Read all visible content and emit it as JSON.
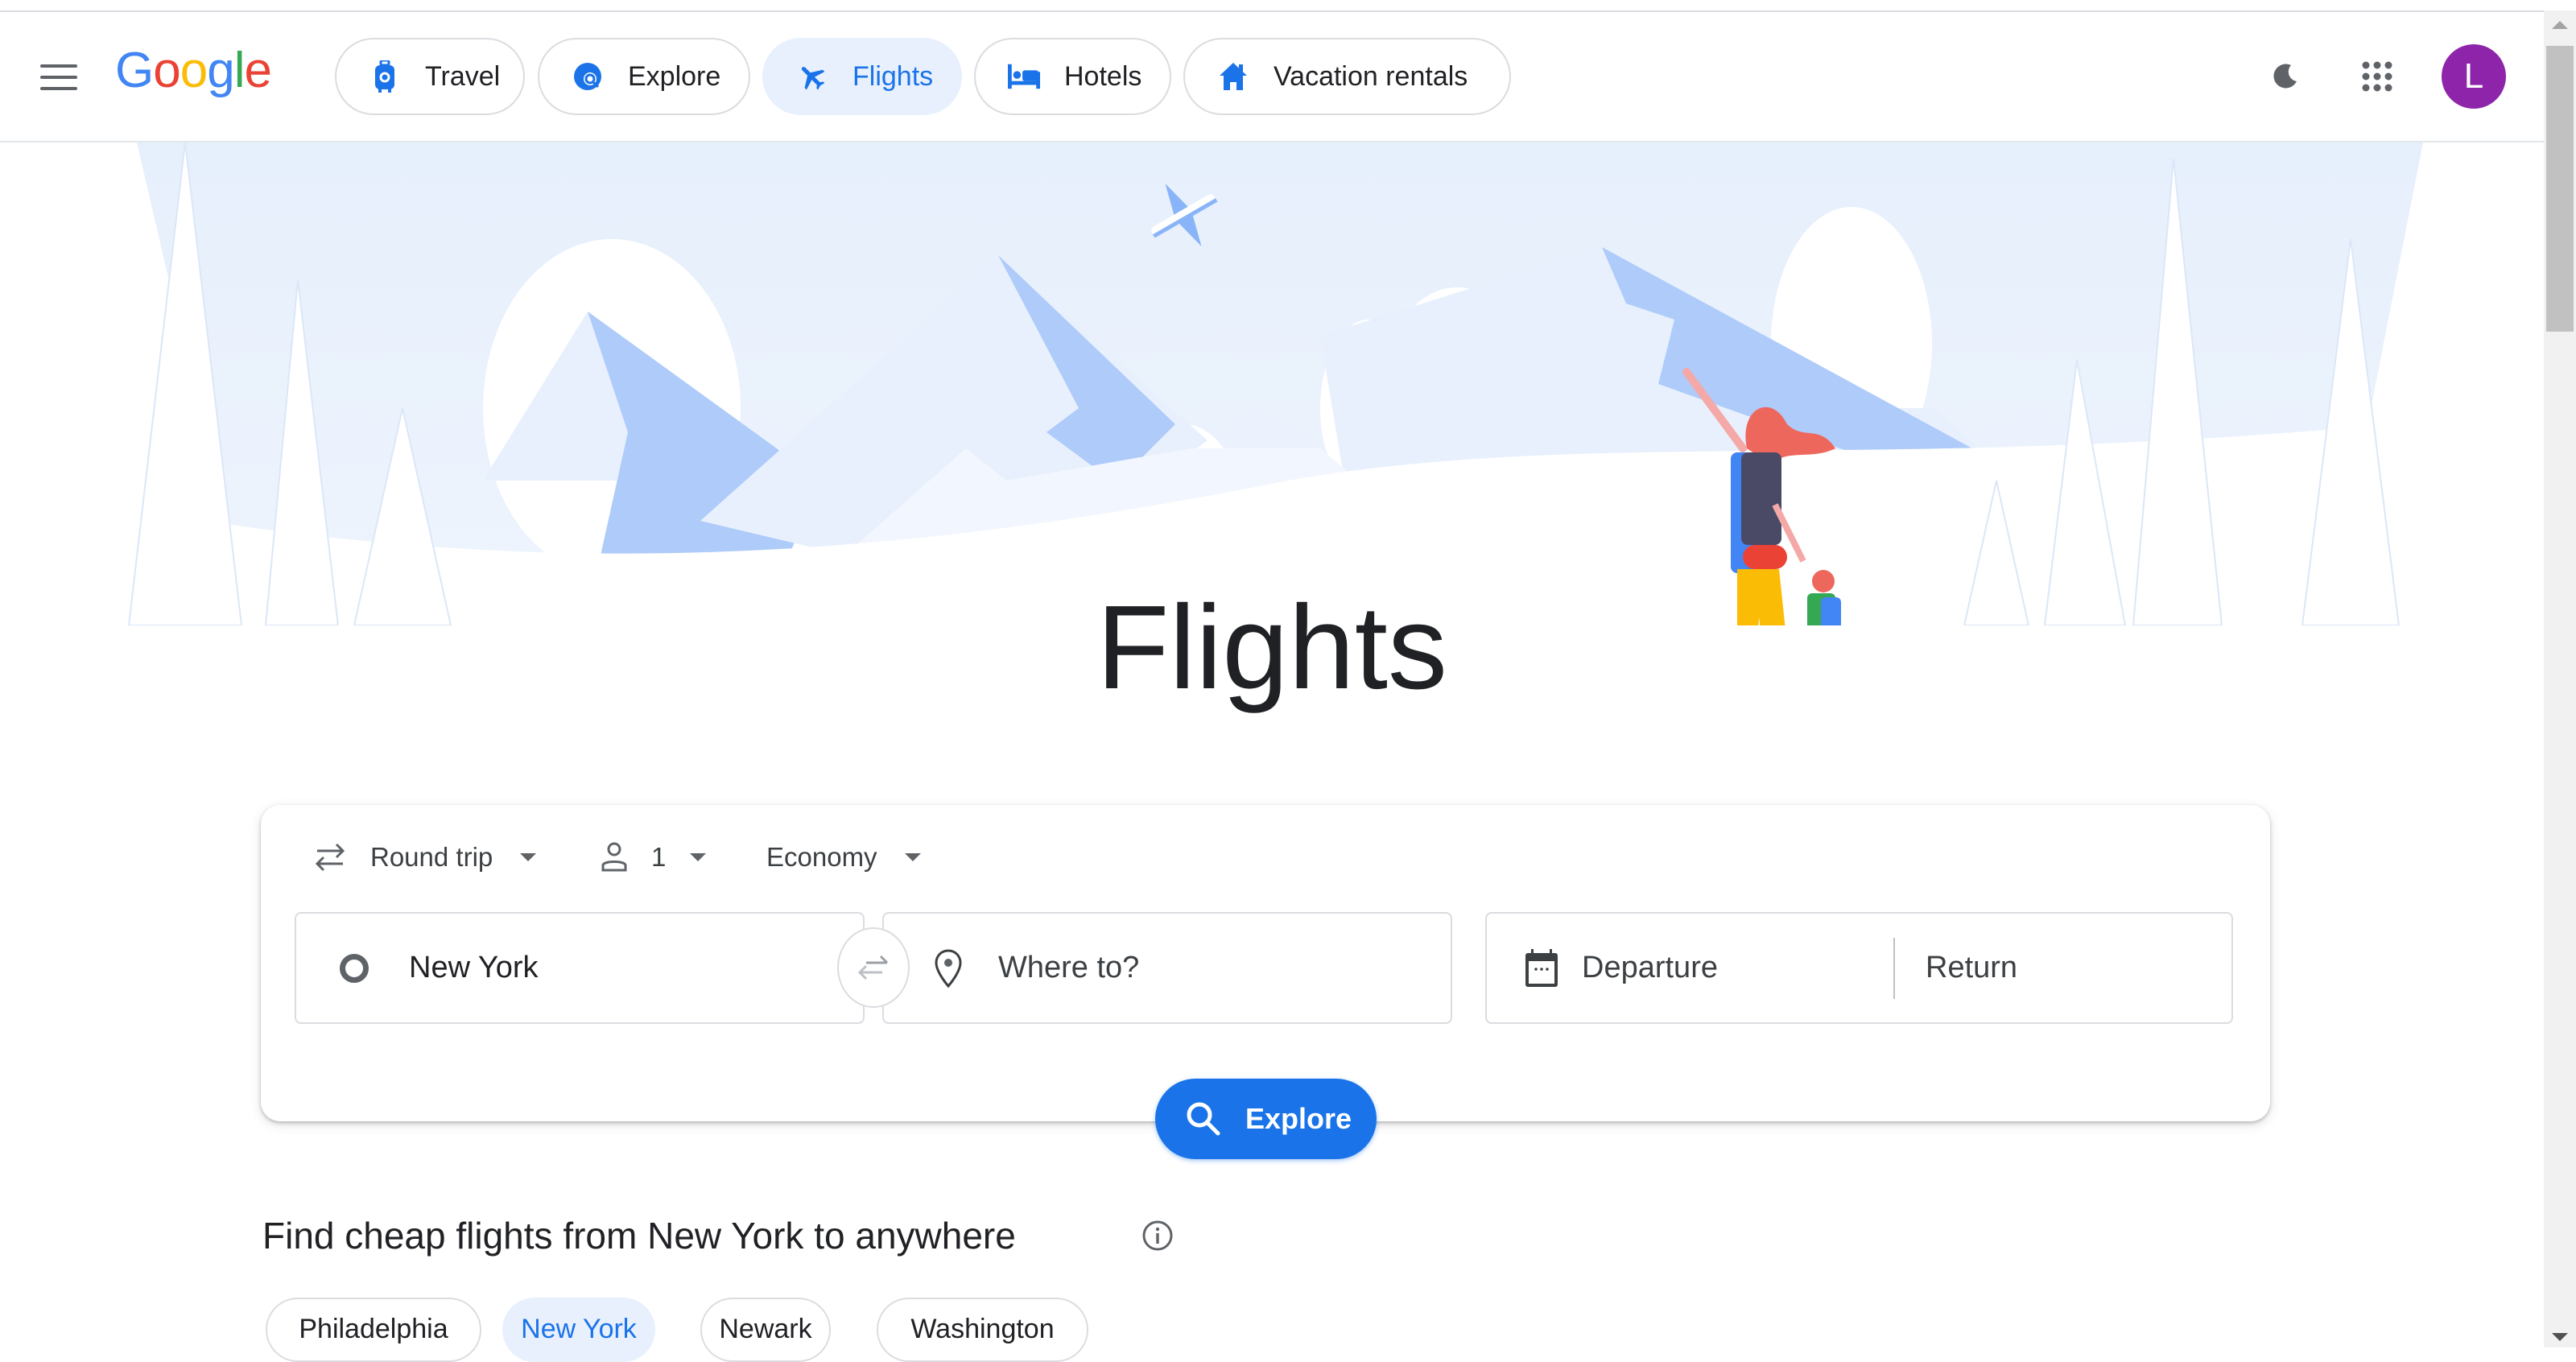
{
  "header": {
    "menu_icon": "hamburger-menu-icon",
    "logo": [
      "G",
      "o",
      "o",
      "g",
      "l",
      "e"
    ],
    "logo_colors": [
      "#4285f4",
      "#ea4335",
      "#fbbc05",
      "#4285f4",
      "#34a853",
      "#ea4335"
    ],
    "tabs": [
      {
        "label": "Travel",
        "icon": "luggage-icon",
        "active": false
      },
      {
        "label": "Explore",
        "icon": "globe-search-icon",
        "active": false
      },
      {
        "label": "Flights",
        "icon": "airplane-icon",
        "active": true
      },
      {
        "label": "Hotels",
        "icon": "bed-icon",
        "active": false
      },
      {
        "label": "Vacation rentals",
        "icon": "house-icon",
        "active": false
      }
    ],
    "dark_mode_icon": "moon-icon",
    "apps_icon": "apps-grid-icon",
    "avatar_initial": "L",
    "avatar_color": "#8e24aa"
  },
  "hero": {
    "title": "Flights"
  },
  "search": {
    "trip_type": "Round trip",
    "passengers": "1",
    "cabin_class": "Economy",
    "origin_value": "New York",
    "destination_placeholder": "Where to?",
    "departure_placeholder": "Departure",
    "return_placeholder": "Return",
    "explore_label": "Explore",
    "accent": "#1a73e8"
  },
  "cheap_flights": {
    "heading": "Find cheap flights from New York to anywhere",
    "cities": [
      {
        "label": "Philadelphia",
        "active": false
      },
      {
        "label": "New York",
        "active": true
      },
      {
        "label": "Newark",
        "active": false
      },
      {
        "label": "Washington",
        "active": false
      }
    ]
  }
}
